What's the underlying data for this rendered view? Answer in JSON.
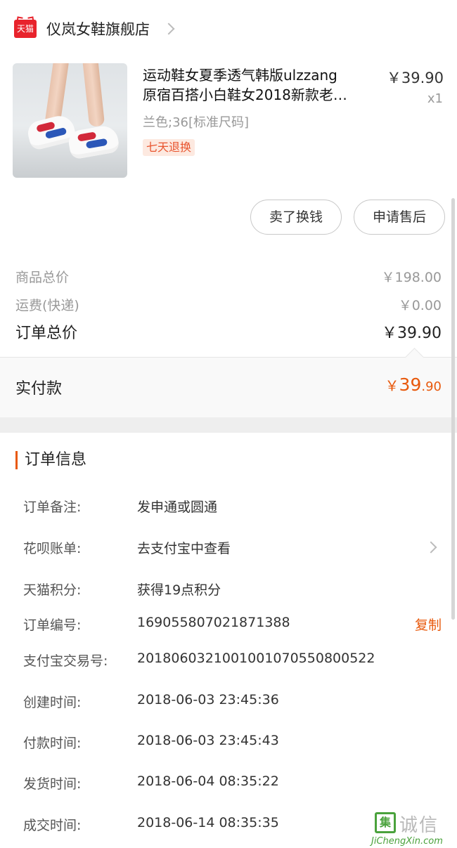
{
  "shop": {
    "logo_text": "天猫",
    "name": "仪岚女鞋旗舰店"
  },
  "product": {
    "title_line1": "运动鞋女夏季透气韩版ulzzang",
    "title_line2": "原宿百搭小白鞋女2018新款老…",
    "price": "￥39.90",
    "quantity": "x1",
    "sku": "兰色;36[标准尺码]",
    "badge": "七天退换"
  },
  "actions": {
    "sell_label": "卖了换钱",
    "after_sale_label": "申请售后"
  },
  "summary": {
    "goods_total_label": "商品总价",
    "goods_total_value": "￥198.00",
    "shipping_label": "运费(快递)",
    "shipping_value": "￥0.00",
    "order_total_label": "订单总价",
    "order_total_value": "￥39.90",
    "paid_label": "实付款",
    "paid_currency": "￥",
    "paid_integer": "39",
    "paid_decimal": ".90"
  },
  "order_info": {
    "section_title": "订单信息",
    "rows": [
      {
        "key": "订单备注:",
        "value": "发申通或圆通"
      },
      {
        "key": "花呗账单:",
        "value": "去支付宝中查看"
      },
      {
        "key": "天猫积分:",
        "value": "获得19点积分"
      },
      {
        "key": "订单编号:",
        "value": "169055807021871388"
      },
      {
        "key": "支付宝交易号:",
        "value": "2018060321001001070550800522"
      },
      {
        "key": "创建时间:",
        "value": "2018-06-03 23:45:36"
      },
      {
        "key": "付款时间:",
        "value": "2018-06-03 23:45:43"
      },
      {
        "key": "发货时间:",
        "value": "2018-06-04 08:35:22"
      },
      {
        "key": "成交时间:",
        "value": "2018-06-14 08:35:35"
      }
    ],
    "copy_label": "复制"
  },
  "watermark": {
    "badge": "集",
    "text": "诚信",
    "url": "JiChengXin.com"
  },
  "colors": {
    "accent": "#e8590c",
    "tmall_red": "#e8232c"
  }
}
